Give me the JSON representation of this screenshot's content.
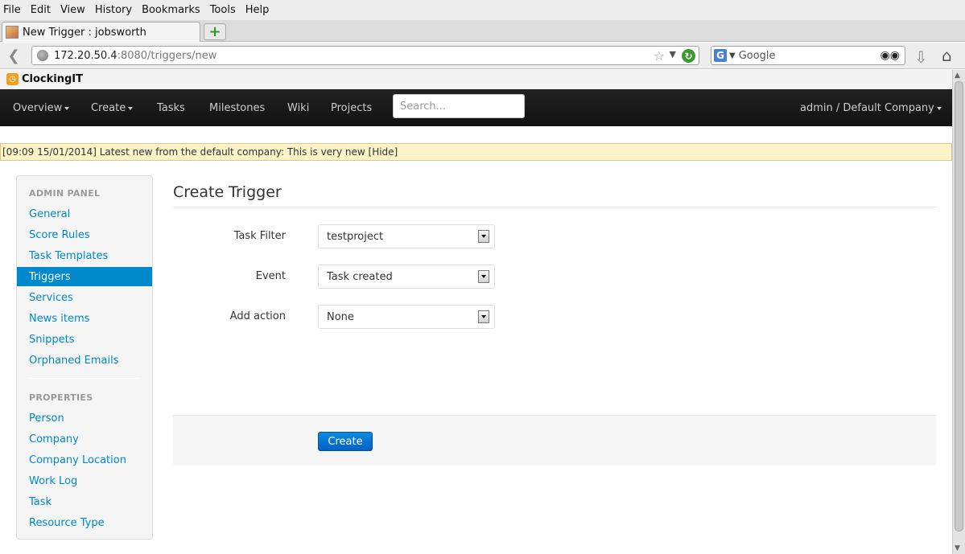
{
  "browser": {
    "menu": [
      "File",
      "Edit",
      "View",
      "History",
      "Bookmarks",
      "Tools",
      "Help"
    ],
    "tab_title": "New Trigger : jobsworth",
    "new_tab_icon": "plus-icon",
    "url_host": "172.20.50.4",
    "url_path": ":8080/triggers/new",
    "search_engine": "G",
    "search_placeholder": "Google"
  },
  "app": {
    "brand": "ClockingIT",
    "nav": {
      "overview": "Overview",
      "create": "Create",
      "tasks": "Tasks",
      "milestones": "Milestones",
      "wiki": "Wiki",
      "projects": "Projects",
      "search_placeholder": "Search...",
      "user": "admin / Default Company"
    },
    "alert": "[09:09 15/01/2014] Latest new from the default company: This is very new [Hide]"
  },
  "sidebar": {
    "admin_header": "ADMIN PANEL",
    "admin_items": [
      "General",
      "Score Rules",
      "Task Templates",
      "Triggers",
      "Services",
      "News items",
      "Snippets",
      "Orphaned Emails"
    ],
    "active_item": "Triggers",
    "properties_header": "PROPERTIES",
    "property_items": [
      "Person",
      "Company",
      "Company Location",
      "Work Log",
      "Task",
      "Resource Type"
    ]
  },
  "form": {
    "title": "Create Trigger",
    "task_filter_label": "Task Filter",
    "task_filter_value": "testproject",
    "event_label": "Event",
    "event_value": "Task created",
    "add_action_label": "Add action",
    "add_action_value": "None",
    "submit_label": "Create"
  },
  "colors": {
    "accent": "#0088cc",
    "nav_bg": "#111111",
    "alert_bg": "#fcf3c8"
  }
}
